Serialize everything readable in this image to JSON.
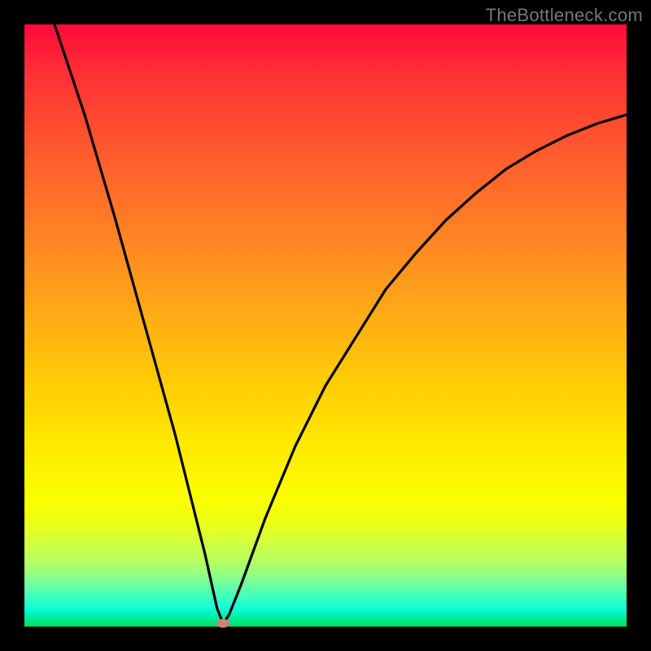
{
  "watermark": "TheBottleneck.com",
  "colors": {
    "marker": "#ca8376",
    "curve_stroke": "#000000"
  },
  "chart_data": {
    "type": "line",
    "title": "",
    "xlabel": "",
    "ylabel": "",
    "xlim": [
      0,
      100
    ],
    "ylim": [
      0,
      100
    ],
    "grid": false,
    "legend": false,
    "minimum_point": {
      "x": 33,
      "y": 0.5
    },
    "series": [
      {
        "name": "bottleneck-curve",
        "x": [
          5,
          10,
          15,
          20,
          25,
          30,
          32,
          33,
          34,
          36,
          40,
          45,
          50,
          55,
          60,
          65,
          70,
          75,
          80,
          85,
          90,
          95,
          100
        ],
        "y": [
          100,
          85,
          68,
          50,
          32,
          12,
          3,
          0.5,
          2,
          7,
          18,
          30,
          40,
          48,
          56,
          62,
          67.5,
          72,
          76,
          79,
          81.5,
          83.5,
          85
        ]
      }
    ]
  }
}
